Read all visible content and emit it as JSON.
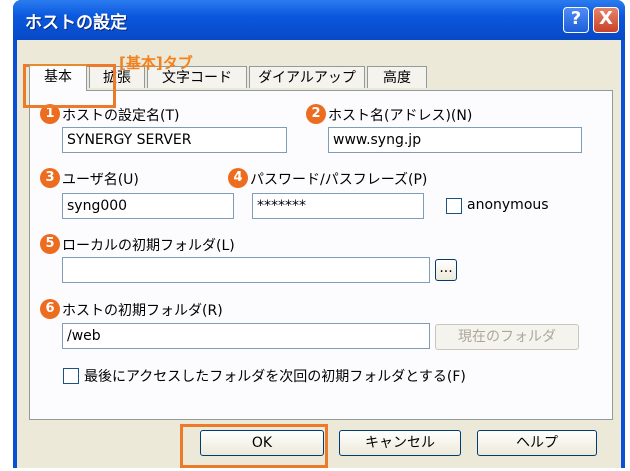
{
  "window": {
    "title": "ホストの設定",
    "help_button": "?",
    "close_button": "X"
  },
  "tabs": [
    "基本",
    "拡張",
    "文字コード",
    "ダイアルアップ",
    "高度"
  ],
  "callout": "[基本]タブ",
  "fields": {
    "host_name_label": "ホストの設定名(T)",
    "host_name_value": "SYNERGY SERVER",
    "address_label": "ホスト名(アドレス)(N)",
    "address_value": "www.syng.jp",
    "user_label": "ユーザ名(U)",
    "user_value": "syng000",
    "password_label": "パスワード/パスフレーズ(P)",
    "password_value": "*******",
    "anonymous_label": "anonymous",
    "local_folder_label": "ローカルの初期フォルダ(L)",
    "local_folder_value": "",
    "browse_button": "...",
    "host_folder_label": "ホストの初期フォルダ(R)",
    "host_folder_value": "/web",
    "current_folder_button": "現在のフォルダ",
    "last_folder_label": "最後にアクセスしたフォルダを次回の初期フォルダとする(F)"
  },
  "markers": [
    "1",
    "2",
    "3",
    "4",
    "5",
    "6"
  ],
  "buttons": {
    "ok": "OK",
    "cancel": "キャンセル",
    "help": "ヘルプ"
  },
  "colors": {
    "marker": "#ec6d1f",
    "titlebar": "#0a58de",
    "dialog": "#ece9d8"
  }
}
